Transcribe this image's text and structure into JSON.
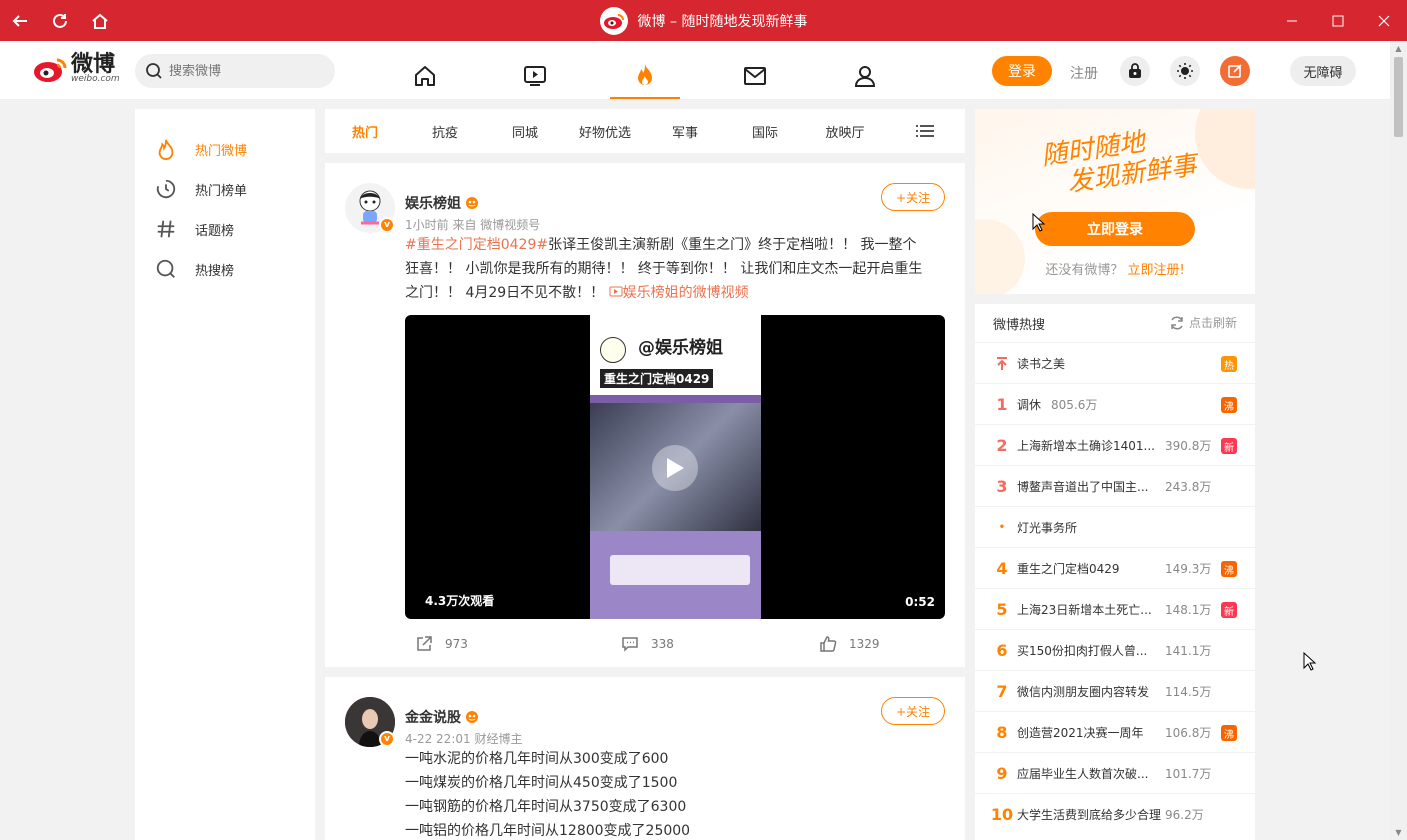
{
  "window": {
    "title": "微博 – 随时随地发现新鲜事"
  },
  "nav": {
    "logo_cn": "微博",
    "logo_en": "weibo.com",
    "search_placeholder": "搜索微博",
    "login_label": "登录",
    "register_label": "注册",
    "accessibility_label": "无障碍"
  },
  "sidebar": {
    "items": [
      {
        "label": "热门微博",
        "icon": "fire-icon",
        "active": true
      },
      {
        "label": "热门榜单",
        "icon": "clock-icon"
      },
      {
        "label": "话题榜",
        "icon": "hashtag-icon"
      },
      {
        "label": "热搜榜",
        "icon": "search-icon"
      }
    ]
  },
  "tabs": [
    "热门",
    "抗疫",
    "同城",
    "好物优选",
    "军事",
    "国际",
    "放映厅"
  ],
  "posts": [
    {
      "author": "娱乐榜姐",
      "meta": "1小时前  来自 微博视频号",
      "follow_label": "+关注",
      "tag": "#重生之门定档0429#",
      "text": "张译王俊凯主演新剧《重生之门》终于定档啦！！ 我一整个狂喜！！ 小凯你是我所有的期待！！ 终于等到你！！ 让我们和庄文杰一起开启重生之门！！ 4月29日不见不散！！ ",
      "video_link": "娱乐榜姐的微博视频",
      "video_views": "4.3万次观看",
      "video_duration": "0:52",
      "video_caption_1": "@娱乐榜姐",
      "video_caption_2": "重生之门定档0429",
      "reposts": "973",
      "comments": "338",
      "likes": "1329"
    },
    {
      "author": "金金说股",
      "meta": "4-22 22:01  财经博主",
      "follow_label": "+关注",
      "lines": [
        "一吨水泥的价格几年时间从300变成了600",
        "一吨煤炭的价格几年时间从450变成了1500",
        "一吨钢筋的价格几年时间从3750变成了6300",
        "一吨铝的价格几年时间从12800变成了25000"
      ]
    }
  ],
  "login_card": {
    "slogan_1": "随时随地",
    "slogan_2": "发现新鲜事",
    "login_now": "立即登录",
    "no_account": "还没有微博？",
    "register_now": "立即注册!"
  },
  "hot_search": {
    "title": "微博热搜",
    "refresh_label": "点击刷新",
    "items": [
      {
        "rank": "",
        "title": "读书之美",
        "count": "",
        "badge": "热",
        "badge_type": "hot",
        "pinned": true
      },
      {
        "rank": "1",
        "title": "调休",
        "count": "805.6万",
        "badge": "沸",
        "badge_type": "boil"
      },
      {
        "rank": "2",
        "title": "上海新增本土确诊1401...",
        "count": "390.8万",
        "badge": "新",
        "badge_type": "new"
      },
      {
        "rank": "3",
        "title": "博鳌声音道出了中国主...",
        "count": "243.8万",
        "badge": "",
        "badge_type": ""
      },
      {
        "rank": "•",
        "title": "灯光事务所",
        "count": "",
        "badge": "",
        "badge_type": ""
      },
      {
        "rank": "4",
        "title": "重生之门定档0429",
        "count": "149.3万",
        "badge": "沸",
        "badge_type": "boil"
      },
      {
        "rank": "5",
        "title": "上海23日新增本土死亡...",
        "count": "148.1万",
        "badge": "新",
        "badge_type": "new"
      },
      {
        "rank": "6",
        "title": "买150份扣肉打假人曾...",
        "count": "141.1万",
        "badge": "",
        "badge_type": ""
      },
      {
        "rank": "7",
        "title": "微信内测朋友圈内容转发",
        "count": "114.5万",
        "badge": "",
        "badge_type": ""
      },
      {
        "rank": "8",
        "title": "创造营2021决赛一周年",
        "count": "106.8万",
        "badge": "沸",
        "badge_type": "boil"
      },
      {
        "rank": "9",
        "title": "应届毕业生人数首次破...",
        "count": "101.7万",
        "badge": "",
        "badge_type": ""
      },
      {
        "rank": "10",
        "title": "大学生活费到底给多少合理",
        "count": "96.2万",
        "badge": "",
        "badge_type": ""
      }
    ]
  },
  "colors": {
    "titlebar": "#d6262f",
    "accent": "#ff8200",
    "tag": "#eb7350"
  }
}
